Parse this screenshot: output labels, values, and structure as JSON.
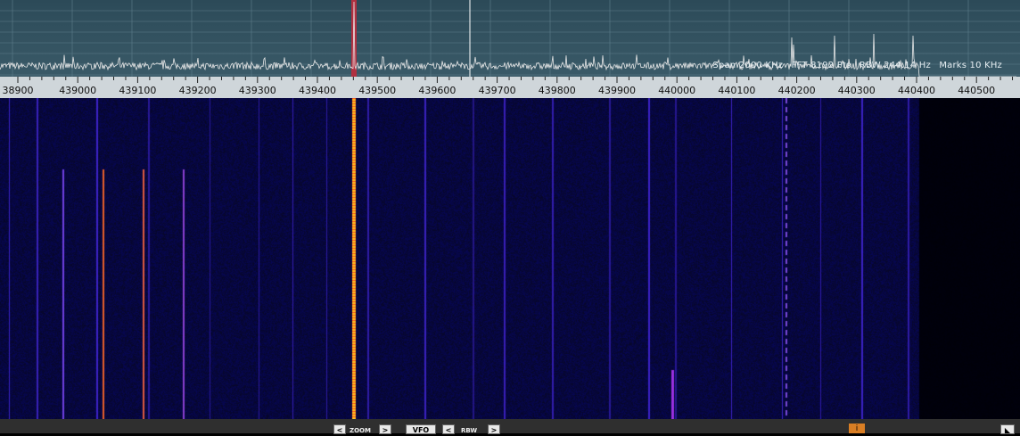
{
  "stats": {
    "span": "Span 2000 KHz",
    "fft": "FFT 8192 Pts",
    "rbw": "RBW 244.14 Hz",
    "marks": "Marks 10 KHz"
  },
  "freq_labels": [
    "38900",
    "439000",
    "439100",
    "439200",
    "439300",
    "439400",
    "439500",
    "439600",
    "439700",
    "439800",
    "439900",
    "440000",
    "440100",
    "440200",
    "440300",
    "440400",
    "440500"
  ],
  "controls": {
    "zoom_prev": "<",
    "zoom_label": "ZOOM",
    "zoom_next": ">",
    "vfo_label": "VFO",
    "rbw_prev": "<",
    "rbw_label": "RBW",
    "rbw_next": ">",
    "info_label": "i",
    "corner_label": "◣"
  },
  "colors": {
    "spectrum_bg": "#2f4f5c",
    "signal_trace": "#e8e8e8",
    "carrier_marker": "#b03040",
    "waterfall_bg": "#05051a",
    "waterfall_line": "#3a22c8",
    "waterfall_hot": "#ffb020"
  }
}
